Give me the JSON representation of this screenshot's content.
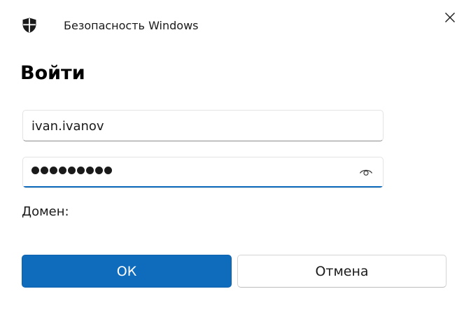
{
  "window": {
    "app_title": "Безопасность Windows",
    "close_icon": "close-icon",
    "shield_icon": "shield-icon"
  },
  "main": {
    "heading": "Войти",
    "username": {
      "value": "ivan.ivanov",
      "placeholder": ""
    },
    "password": {
      "masked_value": "●●●●●●●●●",
      "masked_length": 9,
      "reveal_icon": "eye-icon"
    },
    "domain_label": "Домен:"
  },
  "buttons": {
    "ok_label": "ОК",
    "cancel_label": "Отмена"
  },
  "colors": {
    "accent": "#0f6cbd",
    "text": "#1a1a1a",
    "background": "#ffffff"
  }
}
